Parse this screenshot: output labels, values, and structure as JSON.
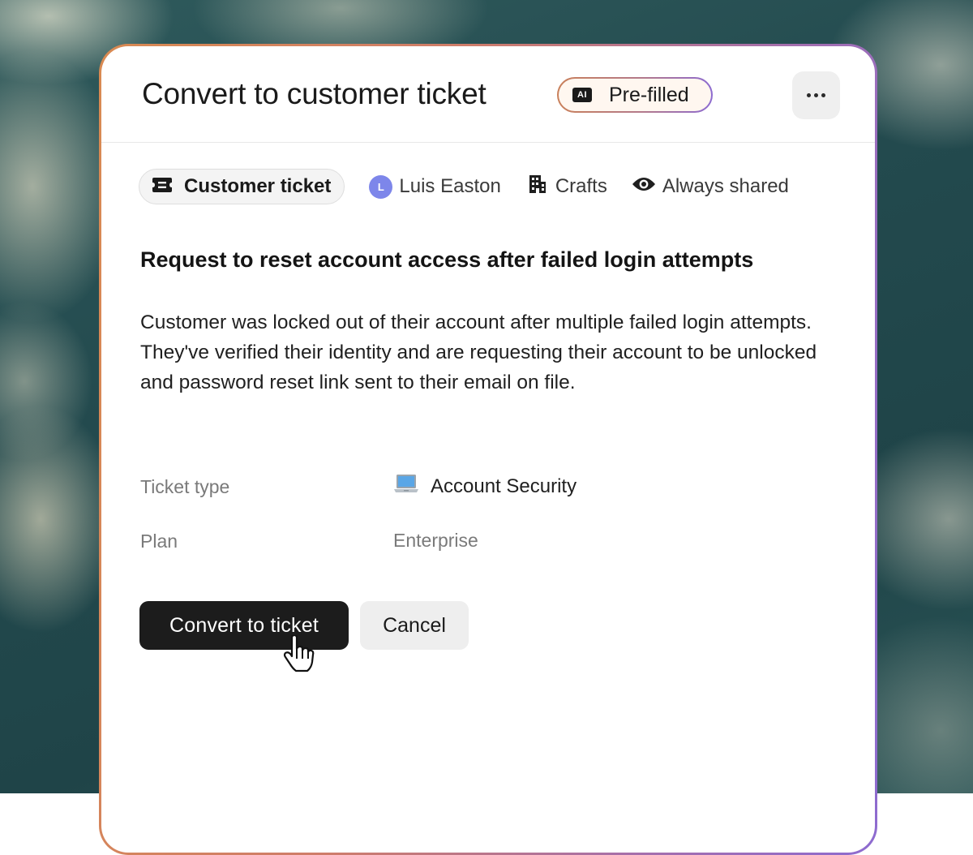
{
  "dialog": {
    "title": "Convert to customer ticket",
    "ai_badge": "AI",
    "ai_label": "Pre-filled",
    "more_icon": "more-horizontal-icon"
  },
  "meta": {
    "type_chip": "Customer ticket",
    "assignee_initial": "L",
    "assignee": "Luis Easton",
    "company": "Crafts",
    "visibility": "Always shared"
  },
  "ticket": {
    "title": "Request to reset account access after failed login attempts",
    "description": "Customer was locked out of their account after multiple failed login attempts. They've verified their identity and are requesting their account to be unlocked and password reset link sent to their email on file."
  },
  "fields": {
    "type_label": "Ticket type",
    "type_value": "Account Security",
    "plan_label": "Plan",
    "plan_value": "Enterprise"
  },
  "actions": {
    "convert_label": "Convert to ticket",
    "cancel_label": "Cancel"
  },
  "colors": {
    "primary_button": "#1c1c1c",
    "avatar": "#7d86ea",
    "border_gradient_start": "#d98a52",
    "border_gradient_end": "#8d6bd0"
  }
}
